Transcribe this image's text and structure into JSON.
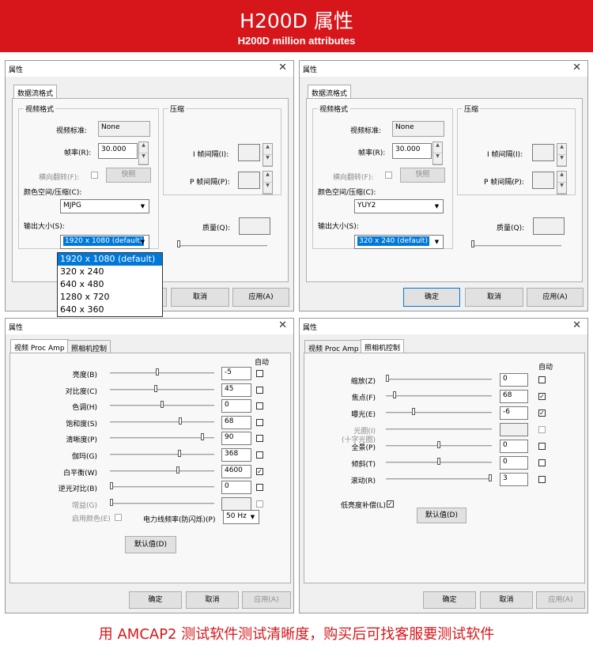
{
  "banner": {
    "title": "H200D 属性",
    "subtitle": "H200D  million attributes"
  },
  "footer": "用 AMCAP2 测试软件测试清晰度，购买后可找客服要测试软件",
  "dlg1": {
    "title": "属性",
    "tab": "数据流格式",
    "video_group": "视频格式",
    "compress_group": "压缩",
    "std_label": "视频标准:",
    "std_value": "None",
    "fps_label": "帧率(R):",
    "fps_value": "30.000",
    "flip_label": "横向翻转(F):",
    "snapshot": "快照",
    "color_label": "颜色空间/压缩(C):",
    "color_value": "MJPG",
    "size_label": "输出大小(S):",
    "size_value": "1920 x 1080  (default)",
    "i_label": "I 帧间隔(I):",
    "p_label": "P 帧间隔(P):",
    "q_label": "质量(Q):",
    "cancel": "取消",
    "apply": "应用(A)",
    "options": [
      "1920 x 1080  (default)",
      "320 x 240",
      "640 x 480",
      "1280 x 720",
      "640 x 360"
    ]
  },
  "dlg2": {
    "title": "属性",
    "tab": "数据流格式",
    "video_group": "视频格式",
    "compress_group": "压缩",
    "std_label": "视频标准:",
    "std_value": "None",
    "fps_label": "帧率(R):",
    "fps_value": "30.000",
    "flip_label": "横向翻转(F):",
    "snapshot": "快照",
    "color_label": "颜色空间/压缩(C):",
    "color_value": "YUY2",
    "size_label": "输出大小(S):",
    "size_value": "320 x 240  (default)",
    "i_label": "I 帧间隔(I):",
    "p_label": "P 帧间隔(P):",
    "q_label": "质量(Q):",
    "ok": "确定",
    "cancel": "取消",
    "apply": "应用(A)"
  },
  "dlg3": {
    "title": "属性",
    "tab1": "视频 Proc Amp",
    "tab2": "照相机控制",
    "auto": "自动",
    "rows": [
      {
        "label": "亮度(B)",
        "value": "-5",
        "pos": 0.45,
        "checked": false,
        "disabled": false
      },
      {
        "label": "对比度(C)",
        "value": "45",
        "pos": 0.44,
        "checked": false,
        "disabled": false
      },
      {
        "label": "色调(H)",
        "value": "0",
        "pos": 0.5,
        "checked": false,
        "disabled": false
      },
      {
        "label": "饱和度(S)",
        "value": "68",
        "pos": 0.68,
        "checked": false,
        "disabled": false
      },
      {
        "label": "清晰度(P)",
        "value": "90",
        "pos": 0.9,
        "checked": false,
        "disabled": false
      },
      {
        "label": "伽玛(G)",
        "value": "368",
        "pos": 0.67,
        "checked": false,
        "disabled": false
      },
      {
        "label": "白平衡(W)",
        "value": "4600",
        "pos": 0.66,
        "checked": true,
        "disabled": false
      },
      {
        "label": "逆光对比(B)",
        "value": "0",
        "pos": 0.0,
        "checked": false,
        "disabled": false
      },
      {
        "label": "增益(G)",
        "value": "",
        "pos": 0.0,
        "checked": false,
        "disabled": true
      }
    ],
    "color_enable": "启用颜色(E)",
    "power_label": "电力线频率(防闪烁)(P)",
    "power_value": "50 Hz",
    "default": "默认值(D)",
    "ok": "确定",
    "cancel": "取消",
    "apply": "应用(A)"
  },
  "dlg4": {
    "title": "属性",
    "tab1": "视频 Proc Amp",
    "tab2": "照相机控制",
    "auto": "自动",
    "rows": [
      {
        "label": "缩放(Z)",
        "value": "0",
        "pos": 0.0,
        "checked": false,
        "disabled": false
      },
      {
        "label": "焦点(F)",
        "value": "68",
        "pos": 0.07,
        "checked": true,
        "disabled": false
      },
      {
        "label": "曝光(E)",
        "value": "-6",
        "pos": 0.25,
        "checked": true,
        "disabled": false
      },
      {
        "label": "光圈(I)",
        "label2": "(十字光圈)",
        "value": "",
        "pos": 0.0,
        "checked": false,
        "disabled": true
      },
      {
        "label": "全景(P)",
        "value": "0",
        "pos": 0.5,
        "checked": false,
        "disabled": false
      },
      {
        "label": "倾斜(T)",
        "value": "0",
        "pos": 0.5,
        "checked": false,
        "disabled": false
      },
      {
        "label": "滚动(R)",
        "value": "3",
        "pos": 1.0,
        "checked": false,
        "disabled": false
      }
    ],
    "lowlight": "低亮度补偿(L)",
    "default": "默认值(D)",
    "ok": "确定",
    "cancel": "取消",
    "apply": "应用(A)"
  }
}
